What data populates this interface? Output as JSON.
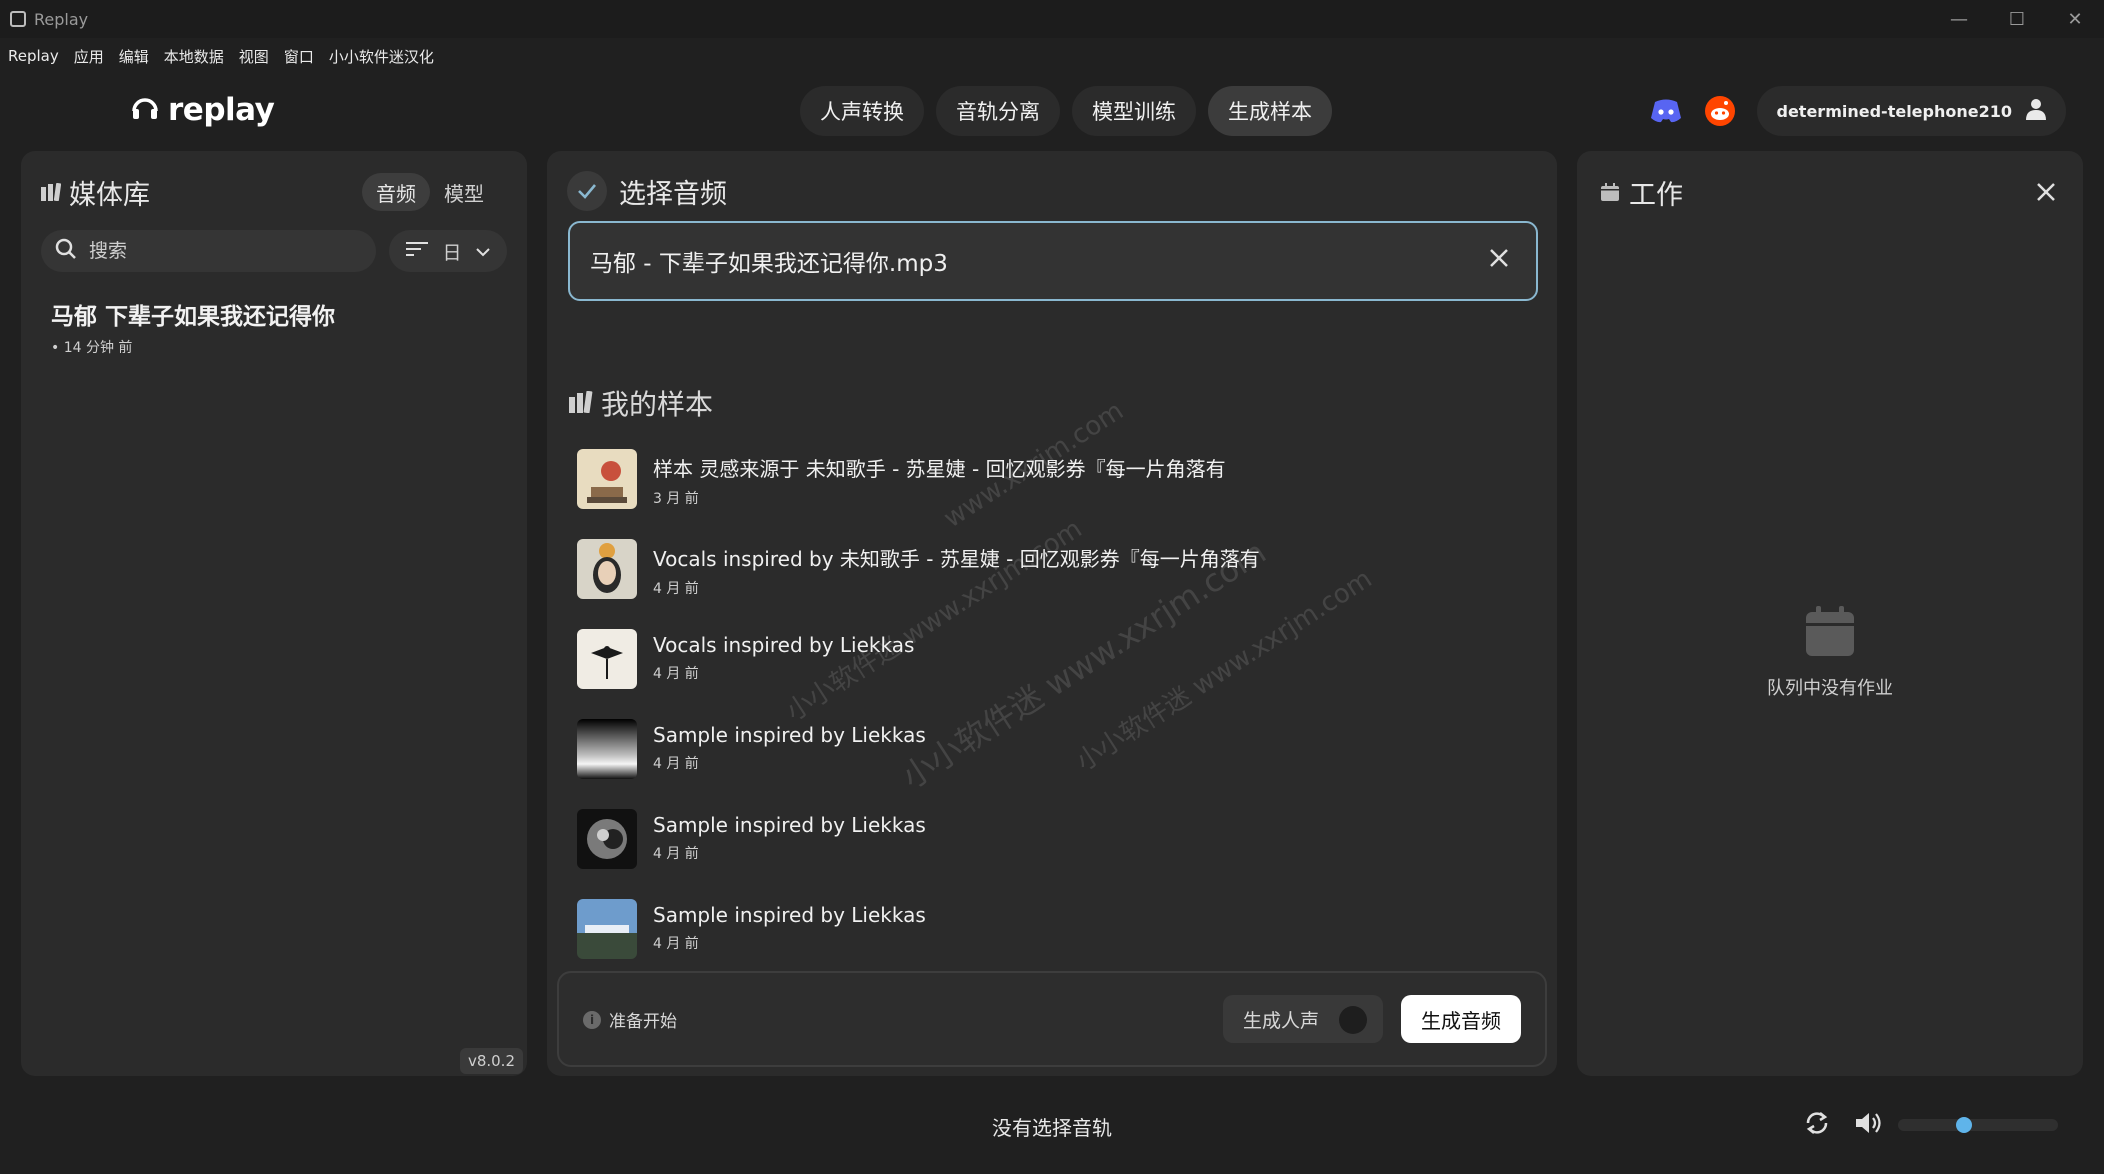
{
  "window": {
    "title": "Replay",
    "minimize": "—",
    "maximize": "☐",
    "close": "✕"
  },
  "menu": [
    "Replay",
    "应用",
    "编辑",
    "本地数据",
    "视图",
    "窗口",
    "小小软件迷汉化"
  ],
  "header": {
    "logo_text": "replay",
    "tabs": [
      {
        "label": "人声转换",
        "active": false
      },
      {
        "label": "音轨分离",
        "active": false
      },
      {
        "label": "模型训练",
        "active": false
      },
      {
        "label": "生成样本",
        "active": true
      }
    ],
    "username": "determined-telephone210"
  },
  "library": {
    "title": "媒体库",
    "segments": [
      {
        "label": "音频",
        "active": true
      },
      {
        "label": "模型",
        "active": false
      }
    ],
    "search_placeholder": "搜索",
    "sort_value": "日",
    "items": [
      {
        "name": "马郁 下辈子如果我还记得你",
        "meta": "• 14 分钟 前"
      }
    ],
    "version": "v8.0.2"
  },
  "main": {
    "select_title": "选择音频",
    "selected_file": "马郁 - 下辈子如果我还记得你.mp3",
    "samples_title": "我的样本",
    "samples": [
      {
        "title": "样本 灵感来源于 未知歌手 - 苏星婕 - 回忆观影券『每一片角落有",
        "meta": "3 月 前",
        "thumb": "poster-icon"
      },
      {
        "title": "Vocals inspired by 未知歌手 - 苏星婕 - 回忆观影券『每一片角落有",
        "meta": "4 月 前",
        "thumb": "portrait-icon"
      },
      {
        "title": "Vocals inspired by Liekkas",
        "meta": "4 月 前",
        "thumb": "ink-art-icon"
      },
      {
        "title": "Sample inspired by Liekkas",
        "meta": "4 月 前",
        "thumb": "horizon-icon"
      },
      {
        "title": "Sample inspired by Liekkas",
        "meta": "4 月 前",
        "thumb": "swirl-icon"
      },
      {
        "title": "Sample inspired by Liekkas",
        "meta": "4 月 前",
        "thumb": "landscape-icon"
      }
    ],
    "status": "准备开始",
    "toggle_label": "生成人声",
    "toggle_on": false,
    "generate_label": "生成音频"
  },
  "jobs": {
    "title": "工作",
    "empty_text": "队列中没有作业"
  },
  "player": {
    "now_playing": "没有选择音轨",
    "volume": 0.4,
    "accent": "#5fb4ea"
  },
  "watermark": [
    "www.xxrjm.com",
    "小小软件迷 www.xxrjm.com",
    "小小软件迷 www.xxrjm.com",
    "小小软件迷 www.xxrjm.com"
  ]
}
